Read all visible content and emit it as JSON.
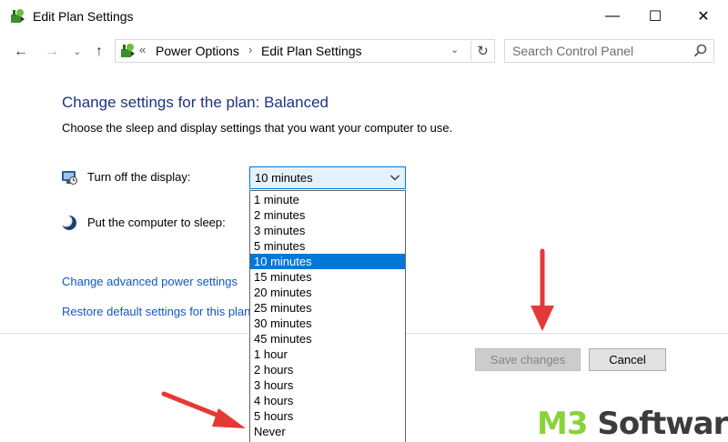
{
  "window": {
    "title": "Edit Plan Settings",
    "minimize_glyph": "—",
    "maximize_glyph": "☐",
    "close_glyph": "✕"
  },
  "nav": {
    "back_glyph": "←",
    "forward_glyph": "→",
    "recent_glyph": "⌄",
    "up_glyph": "↑",
    "breadcrumb_prefix": "«",
    "breadcrumbs": [
      "Power Options",
      "Edit Plan Settings"
    ],
    "separator": "›",
    "dropdown_glyph": "⌄",
    "refresh_glyph": "↻",
    "search_placeholder": "Search Control Panel"
  },
  "content": {
    "heading": "Change settings for the plan: Balanced",
    "subtext": "Choose the sleep and display settings that you want your computer to use.",
    "display_label": "Turn off the display:",
    "sleep_label": "Put the computer to sleep:",
    "link_advanced": "Change advanced power settings",
    "link_restore": "Restore default settings for this plan"
  },
  "display_select": {
    "value": "10 minutes",
    "options": [
      "1 minute",
      "2 minutes",
      "3 minutes",
      "5 minutes",
      "10 minutes",
      "15 minutes",
      "20 minutes",
      "25 minutes",
      "30 minutes",
      "45 minutes",
      "1 hour",
      "2 hours",
      "3 hours",
      "4 hours",
      "5 hours",
      "Never"
    ],
    "selected_index": 4
  },
  "buttons": {
    "save": "Save changes",
    "cancel": "Cancel"
  },
  "watermark": {
    "part1": "M3",
    "part2": " Software"
  },
  "colors": {
    "heading": "#1e3287",
    "link": "#0f57c7",
    "selection": "#0078d7",
    "annotation_arrow": "#e53935",
    "watermark_green": "#8bd23a"
  },
  "icons": {
    "title": "power-plan-icon",
    "display": "monitor-clock-icon",
    "sleep": "moon-icon",
    "search": "search-icon"
  }
}
